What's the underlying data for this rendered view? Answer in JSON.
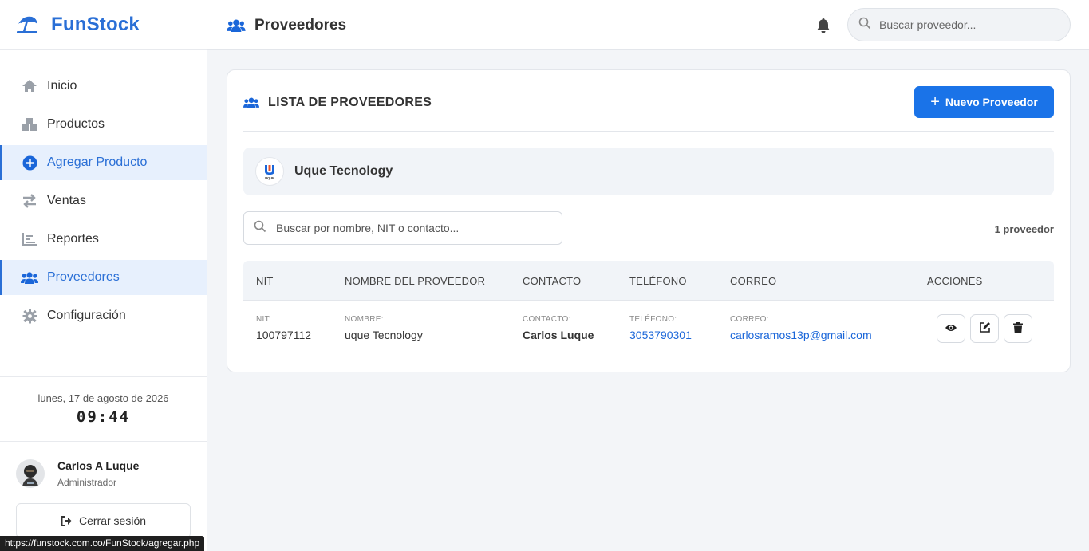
{
  "brand": {
    "name": "FunStock",
    "icon": "beach-umbrella-icon"
  },
  "sidebar": {
    "items": [
      {
        "label": "Inicio",
        "icon": "home-icon",
        "active": false
      },
      {
        "label": "Productos",
        "icon": "boxes-icon",
        "active": false
      },
      {
        "label": "Agregar Producto",
        "icon": "plus-circle-icon",
        "active": true
      },
      {
        "label": "Ventas",
        "icon": "exchange-icon",
        "active": false
      },
      {
        "label": "Reportes",
        "icon": "chart-icon",
        "active": false
      },
      {
        "label": "Proveedores",
        "icon": "users-icon",
        "active": true
      },
      {
        "label": "Configuración",
        "icon": "gear-icon",
        "active": false
      }
    ],
    "date": "lunes, 17 de agosto de 2026",
    "time": "09:44",
    "user": {
      "name": "Carlos A Luque",
      "role": "Administrador"
    },
    "logout_label": "Cerrar sesión"
  },
  "header": {
    "title": "Proveedores",
    "search_placeholder": "Buscar proveedor..."
  },
  "card": {
    "title": "LISTA DE PROVEEDORES",
    "new_button": "Nuevo Proveedor",
    "supplier_chip": {
      "name": "Uque Tecnology",
      "logo_text": "UQUE"
    },
    "filter_placeholder": "Buscar por nombre, NIT o contacto...",
    "count": "1 proveedor"
  },
  "table": {
    "columns": [
      "NIT",
      "NOMBRE DEL PROVEEDOR",
      "CONTACTO",
      "TELÉFONO",
      "CORREO",
      "ACCIONES"
    ],
    "rows": [
      {
        "nit_label": "NIT:",
        "nit": "100797112",
        "name_label": "NOMBRE:",
        "name": "uque Tecnology",
        "contact_label": "CONTACTO:",
        "contact": "Carlos Luque",
        "phone_label": "TELÉFONO:",
        "phone": "3053790301",
        "email_label": "CORREO:",
        "email": "carlosramos13p@gmail.com"
      }
    ]
  },
  "status_bar": {
    "url": "https://funstock.com.co/FunStock/agregar.php"
  },
  "colors": {
    "accent": "#1a73e8",
    "brand": "#2a6fd6",
    "active_bg": "#e7f0fd",
    "link": "#1a66d9"
  }
}
